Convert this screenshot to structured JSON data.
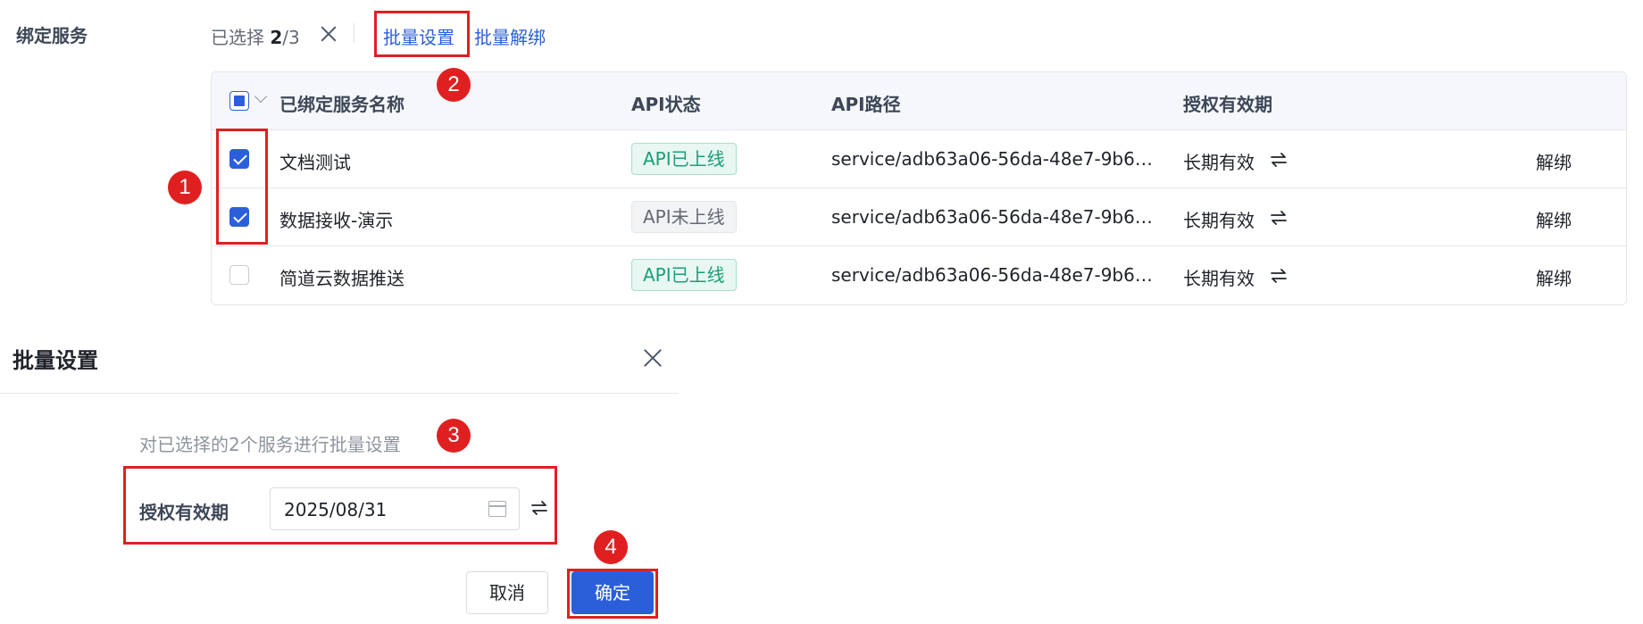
{
  "header": {
    "section_label": "绑定服务",
    "selected_prefix": "已选择 ",
    "selected_count": "2",
    "selected_total": "/3",
    "batch_settings_label": "批量设置",
    "batch_unbind_label": "批量解绑"
  },
  "table": {
    "columns": {
      "name": "已绑定服务名称",
      "api_status": "API状态",
      "api_path": "API路径",
      "auth_validity": "授权有效期"
    },
    "rows": [
      {
        "name": "文档测试",
        "status": "API已上线",
        "path": "service/adb63a06-56da-48e7-9b6c-c...",
        "validity": "长期有效",
        "action": "解绑",
        "checked": true
      },
      {
        "name": "数据接收-演示",
        "status": "API未上线",
        "path": "service/adb63a06-56da-48e7-9b6c-c...",
        "validity": "长期有效",
        "action": "解绑",
        "checked": true
      },
      {
        "name": "简道云数据推送",
        "status": "API已上线",
        "path": "service/adb63a06-56da-48e7-9b6c-c...",
        "validity": "长期有效",
        "action": "解绑",
        "checked": false
      }
    ]
  },
  "dialog": {
    "title": "批量设置",
    "description": "对已选择的2个服务进行批量设置",
    "form_label": "授权有效期",
    "date_value": "2025/08/31",
    "cancel_label": "取消",
    "confirm_label": "确定"
  },
  "annotations": [
    "1",
    "2",
    "3",
    "4"
  ],
  "colors": {
    "accent": "#2b5fd9",
    "annotation": "#e02020",
    "online_text": "#1a9e78",
    "offline_text": "#646a73"
  },
  "icons": [
    "close-icon",
    "chevron-down-icon",
    "swap-icon",
    "calendar-icon"
  ]
}
